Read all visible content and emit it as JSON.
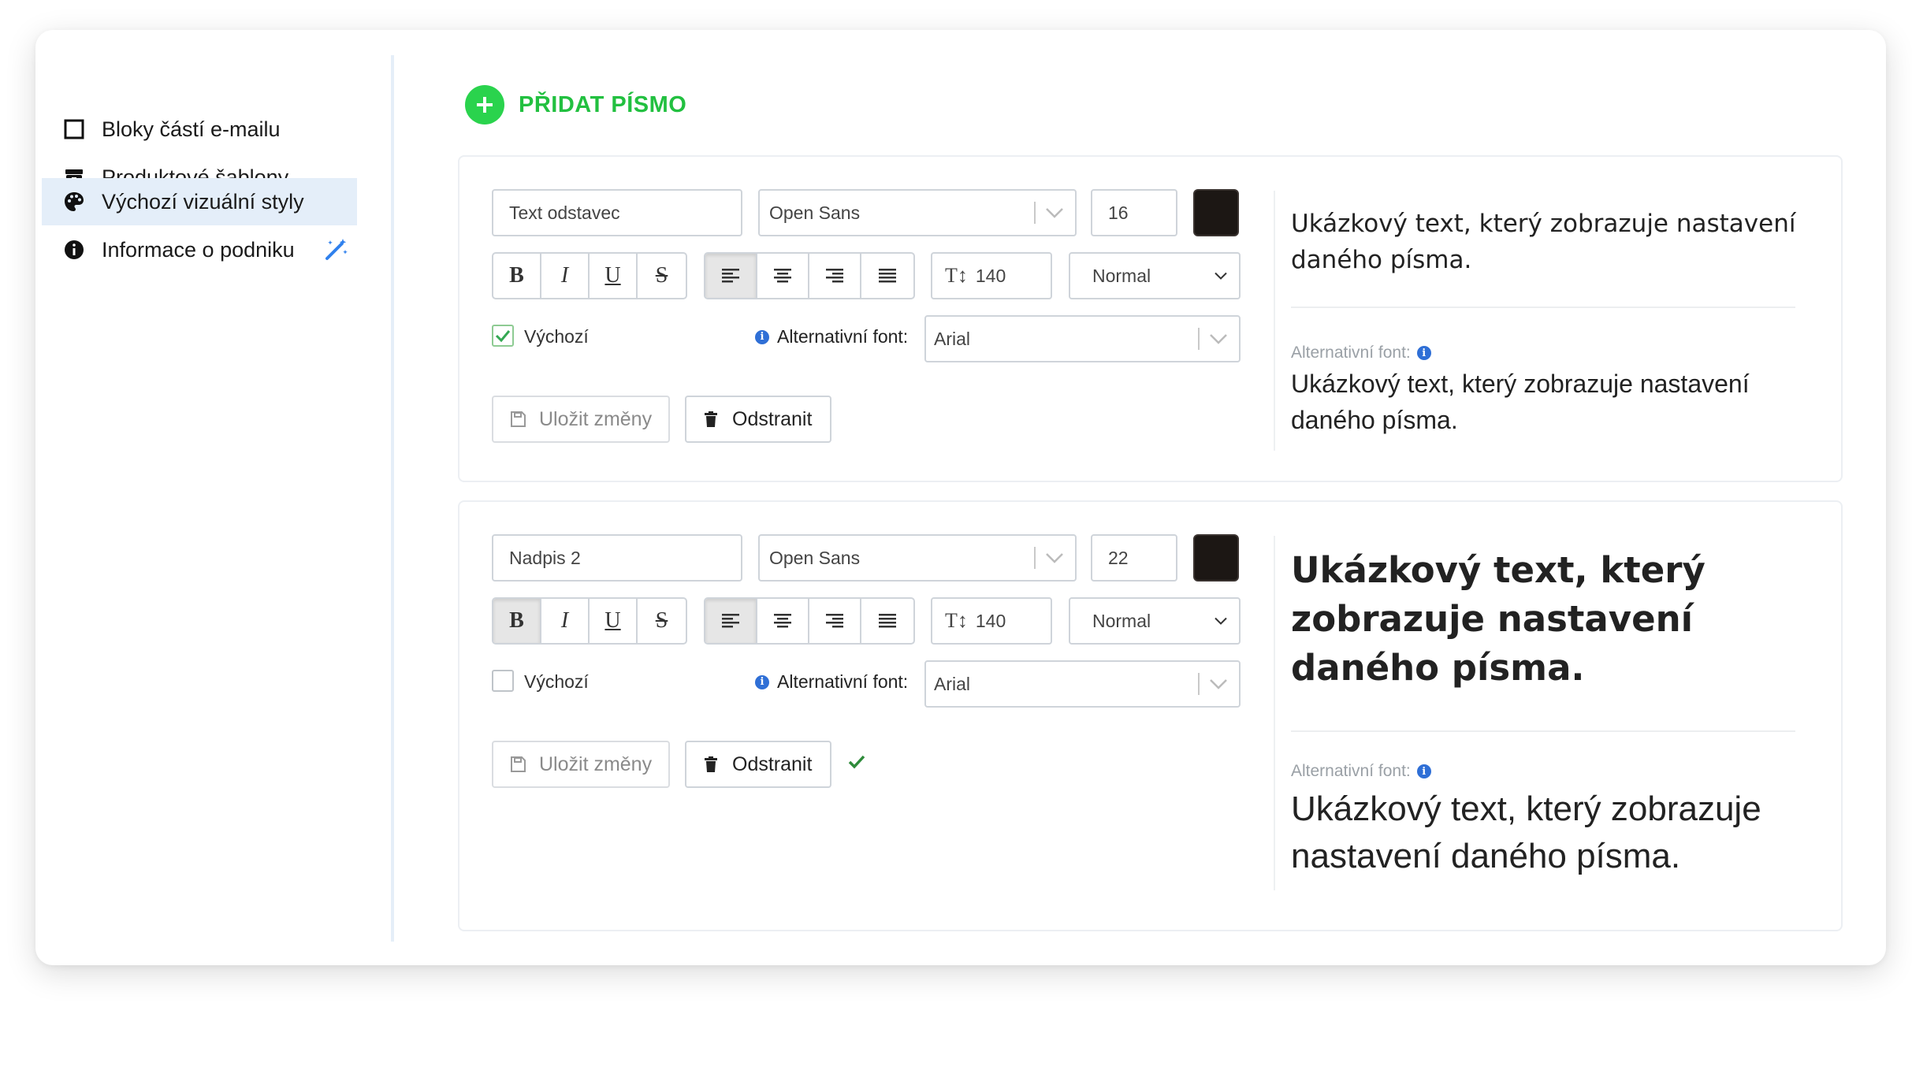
{
  "sidebar": {
    "items": [
      {
        "label": "Bloky částí e-mailu",
        "icon": "square-outline-icon"
      },
      {
        "label": "Produktové šablony",
        "icon": "box-icon"
      },
      {
        "label": "Výchozí vizuální styly",
        "icon": "palette-icon",
        "active": true
      },
      {
        "label": "Informace o podniku",
        "icon": "info-icon",
        "extra_icon": "magic-wand-icon"
      }
    ]
  },
  "add_font": {
    "label": "PŘIDAT PÍSMO"
  },
  "panels": [
    {
      "name": "Text odstavec",
      "font_family": "Open Sans",
      "font_size": "16",
      "color": "#1c1714",
      "bold_active": false,
      "line_height": "140",
      "weight": "Normal",
      "default_label": "Výchozí",
      "default_checked": true,
      "alt_font_label": "Alternativní font:",
      "alt_font": "Arial",
      "save_label": "Uložit změny",
      "delete_label": "Odstranit",
      "preview_text": "Ukázkový text, který zobrazuje nastavení daného písma.",
      "alt_caption": "Alternativní font:",
      "alt_preview_text": "Ukázkový text, který zobrazuje nastavení daného písma."
    },
    {
      "name": "Nadpis 2",
      "font_family": "Open Sans",
      "font_size": "22",
      "color": "#1c1714",
      "bold_active": true,
      "line_height": "140",
      "weight": "Normal",
      "default_label": "Výchozí",
      "default_checked": false,
      "alt_font_label": "Alternativní font:",
      "alt_font": "Arial",
      "save_label": "Uložit změny",
      "delete_label": "Odstranit",
      "saved_check": true,
      "preview_text": "Ukázkový text, který zobrazuje nastavení daného písma.",
      "alt_caption": "Alternativní font:",
      "alt_preview_text": "Ukázkový text, který zobrazuje nastavení daného písma."
    }
  ],
  "colors": {
    "accent_green": "#22c040",
    "active_bg": "#e4eef9",
    "info_blue": "#2f6fd6",
    "check_green": "#2e8b3a"
  }
}
